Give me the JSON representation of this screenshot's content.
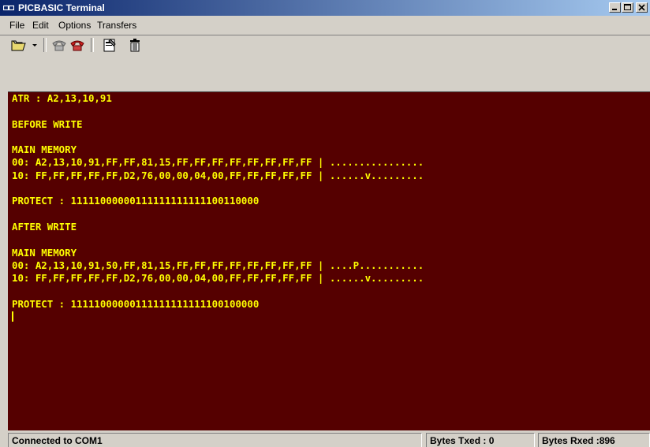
{
  "window": {
    "title": "PICBASIC Terminal",
    "controls": {
      "minimize": "_",
      "maximize": "□",
      "close": "×"
    }
  },
  "menu": [
    {
      "label": "File"
    },
    {
      "label": "Edit"
    },
    {
      "label": "Options"
    },
    {
      "label": "Transfers"
    }
  ],
  "toolbar": {
    "icons": [
      "open-icon",
      "dropdown-arrow-icon",
      "connect-phone-icon",
      "disconnect-phone-icon",
      "properties-icon",
      "delete-icon"
    ]
  },
  "terminal": {
    "lines": [
      "ATR : A2,13,10,91",
      "",
      "BEFORE WRITE",
      "",
      "MAIN MEMORY",
      "00: A2,13,10,91,FF,FF,81,15,FF,FF,FF,FF,FF,FF,FF,FF | ................",
      "10: FF,FF,FF,FF,FF,D2,76,00,00,04,00,FF,FF,FF,FF,FF | ......v.........",
      "",
      "PROTECT : 11111000000111111111111100110000",
      "",
      "AFTER WRITE",
      "",
      "MAIN MEMORY",
      "00: A2,13,10,91,50,FF,81,15,FF,FF,FF,FF,FF,FF,FF,FF | ....P...........",
      "10: FF,FF,FF,FF,FF,D2,76,00,00,04,00,FF,FF,FF,FF,FF | ......v.........",
      "",
      "PROTECT : 11111000000111111111111100100000"
    ]
  },
  "status": {
    "connection": "Connected to COM1",
    "bytes_txed": "Bytes Txed : 0",
    "bytes_rxed": "Bytes Rxed :896"
  },
  "colors": {
    "terminal_bg": "#550000",
    "terminal_fg": "#ffff00",
    "titlebar_start": "#0a246a",
    "titlebar_end": "#a6caf0"
  }
}
